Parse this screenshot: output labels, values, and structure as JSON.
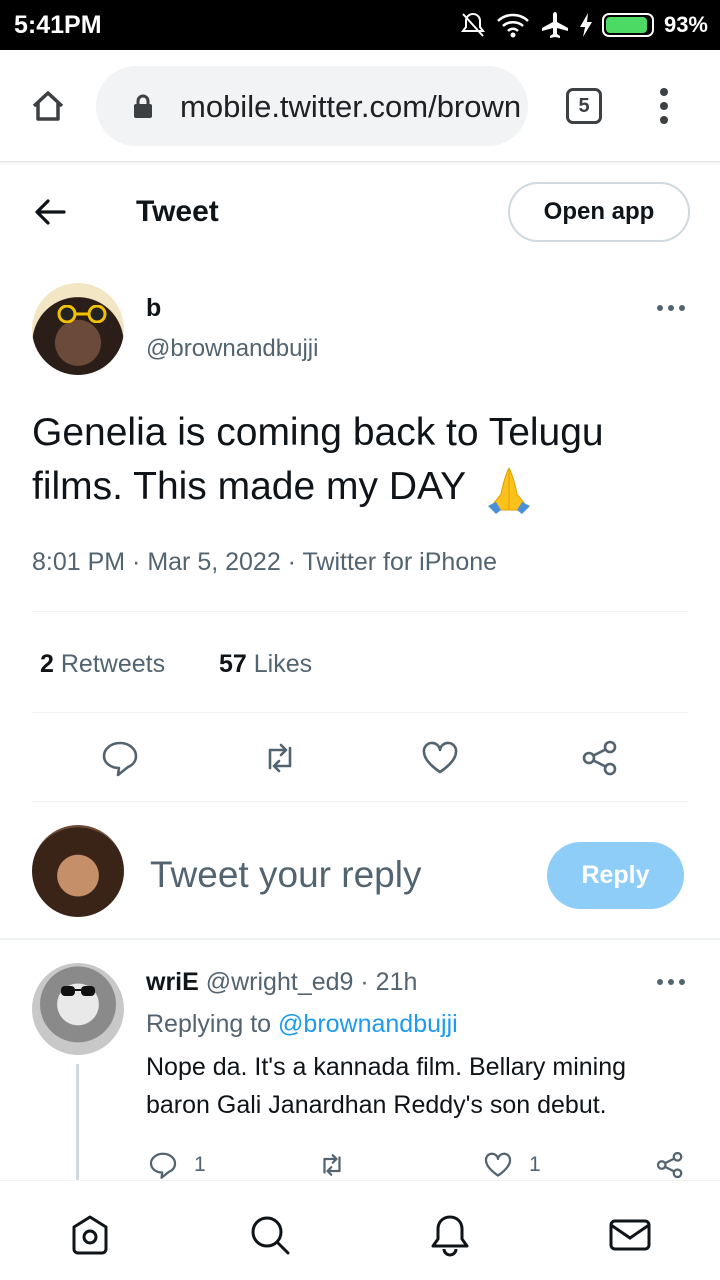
{
  "status_bar": {
    "time": "5:41PM",
    "battery_percent": "93%",
    "battery_level": 0.93,
    "icons": [
      "notifications-off-icon",
      "wifi-icon",
      "airplane-icon",
      "charging-icon",
      "battery-icon"
    ]
  },
  "browser": {
    "url": "mobile.twitter.com/brownandbujji",
    "tab_count": "5",
    "icons": [
      "home-icon",
      "lock-icon",
      "tabs-icon",
      "more-vert-icon"
    ]
  },
  "header": {
    "title": "Tweet",
    "open_app_label": "Open app"
  },
  "tweet": {
    "author_name": "b",
    "author_handle": "@brownandbujji",
    "text": "Genelia is coming back to Telugu films. This made my DAY",
    "emoji": "🙏",
    "meta": "8:01 PM · Mar 5, 2022 · Twitter for iPhone",
    "retweets_count": "2",
    "retweets_label": "Retweets",
    "likes_count": "57",
    "likes_label": "Likes"
  },
  "composer": {
    "placeholder": "Tweet your reply",
    "reply_label": "Reply"
  },
  "reply": {
    "author_name": "wriE",
    "author_handle": "@wright_ed9",
    "time": "· 21h",
    "replying_to_label": "Replying to",
    "replying_to_handle": "@brownandbujji",
    "text": "Nope da. It's a kannada film. Bellary mining baron Gali Janardhan Reddy's son debut.",
    "reply_count": "1",
    "like_count": "1"
  },
  "colors": {
    "accent": "#1d9bf0",
    "reply_button": "#8ecdf8",
    "secondary_text": "#536471"
  },
  "bottom_nav": [
    "home-icon",
    "search-icon",
    "notifications-icon",
    "messages-icon"
  ]
}
